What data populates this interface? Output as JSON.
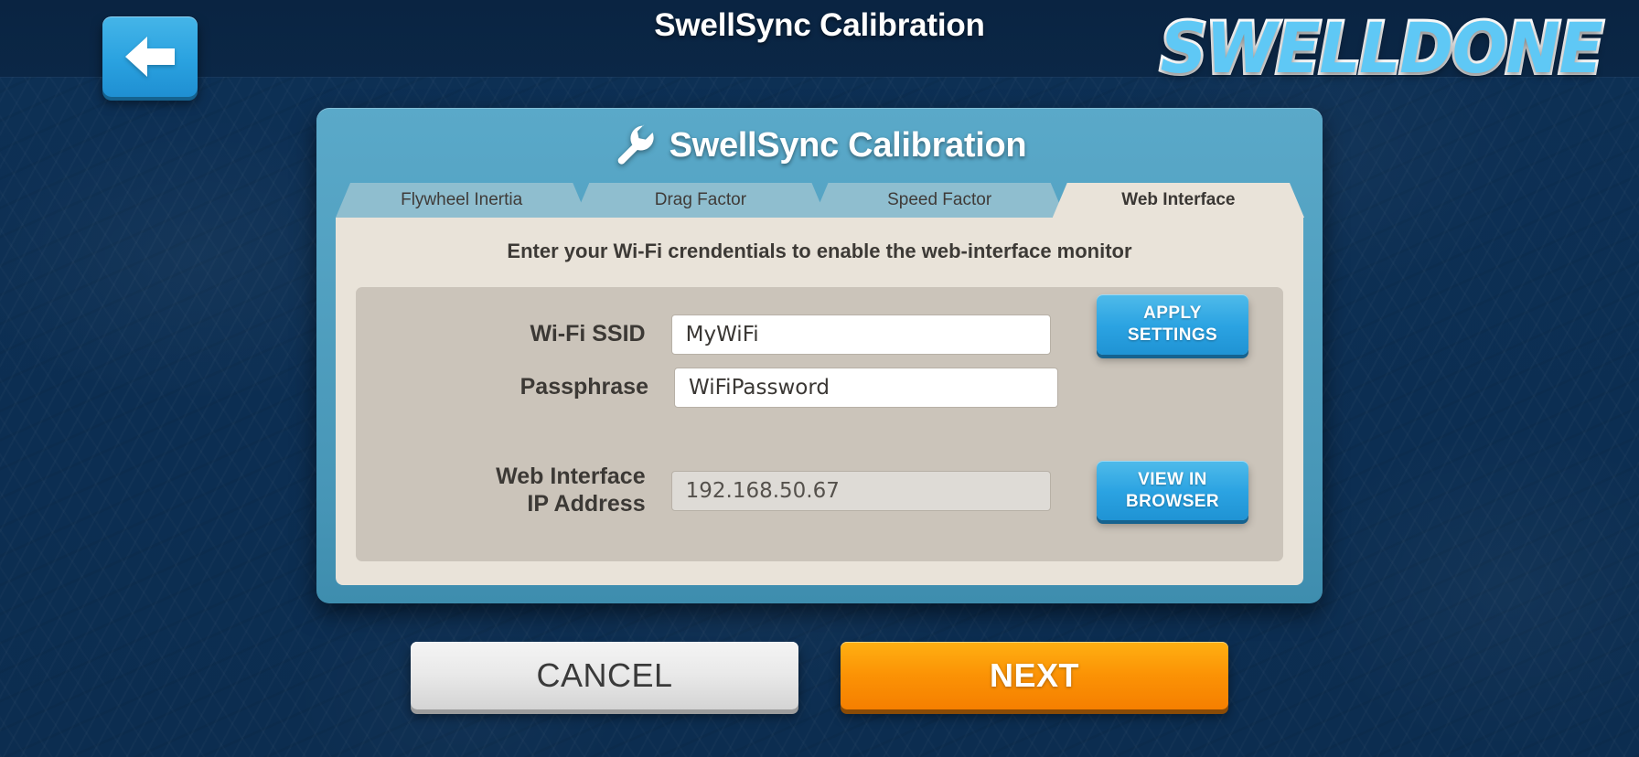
{
  "header": {
    "title": "SwellSync Calibration",
    "back_icon": "back-arrow-icon",
    "logo_text": "SWELLDONE",
    "accent_blue": "#2aa2e0",
    "background_navy": "#0d3055"
  },
  "panel": {
    "icon": "wrench-icon",
    "title": "SwellSync Calibration",
    "tabs": [
      {
        "label": "Flywheel Inertia",
        "active": false
      },
      {
        "label": "Drag Factor",
        "active": false
      },
      {
        "label": "Speed Factor",
        "active": false
      },
      {
        "label": "Web Interface",
        "active": true
      }
    ],
    "instruction": "Enter your Wi-Fi crendentials to enable the web-interface monitor",
    "fields": {
      "ssid_label": "Wi-Fi SSID",
      "ssid_value": "MyWiFi",
      "passphrase_label": "Passphrase",
      "passphrase_value": "WiFiPassword",
      "ip_label_line1": "Web Interface",
      "ip_label_line2": "IP Address",
      "ip_value": "192.168.50.67"
    },
    "buttons": {
      "apply_line1": "APPLY",
      "apply_line2": "SETTINGS",
      "browser_line1": "VIEW IN",
      "browser_line2": "BROWSER"
    }
  },
  "actions": {
    "cancel": "CANCEL",
    "next": "NEXT"
  }
}
